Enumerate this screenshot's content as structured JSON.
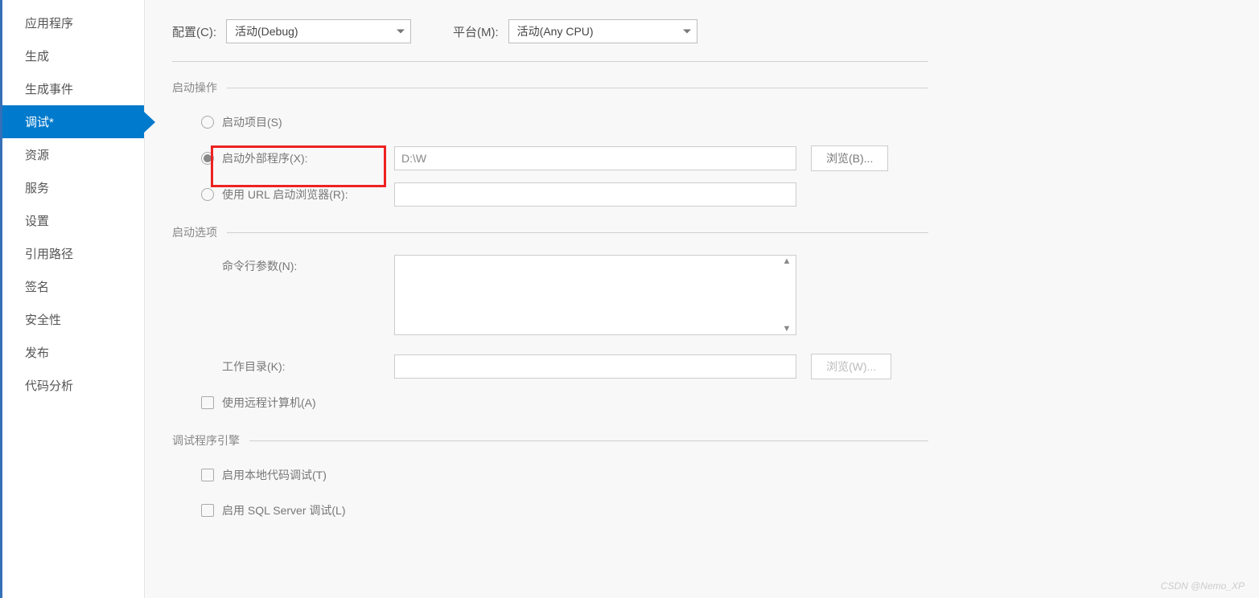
{
  "sidebar": {
    "items": [
      {
        "label": "应用程序"
      },
      {
        "label": "生成"
      },
      {
        "label": "生成事件"
      },
      {
        "label": "调试*"
      },
      {
        "label": "资源"
      },
      {
        "label": "服务"
      },
      {
        "label": "设置"
      },
      {
        "label": "引用路径"
      },
      {
        "label": "签名"
      },
      {
        "label": "安全性"
      },
      {
        "label": "发布"
      },
      {
        "label": "代码分析"
      }
    ],
    "active_index": 3
  },
  "topbar": {
    "config_label": "配置(C):",
    "config_value": "活动(Debug)",
    "platform_label": "平台(M):",
    "platform_value": "活动(Any CPU)"
  },
  "sections": {
    "start_action": {
      "title": "启动操作",
      "opt_project": "启动项目(S)",
      "opt_external": "启动外部程序(X):",
      "external_value": "D:\\W",
      "browse_b": "浏览(B)...",
      "opt_url": "使用 URL 启动浏览器(R):"
    },
    "start_options": {
      "title": "启动选项",
      "cmdline_label": "命令行参数(N):",
      "workdir_label": "工作目录(K):",
      "browse_w": "浏览(W)...",
      "remote_label": "使用远程计算机(A)"
    },
    "debug_engines": {
      "title": "调试程序引擎",
      "native_label": "启用本地代码调试(T)",
      "sql_label": "启用 SQL Server 调试(L)"
    }
  },
  "watermark": "CSDN @Nemo_XP"
}
